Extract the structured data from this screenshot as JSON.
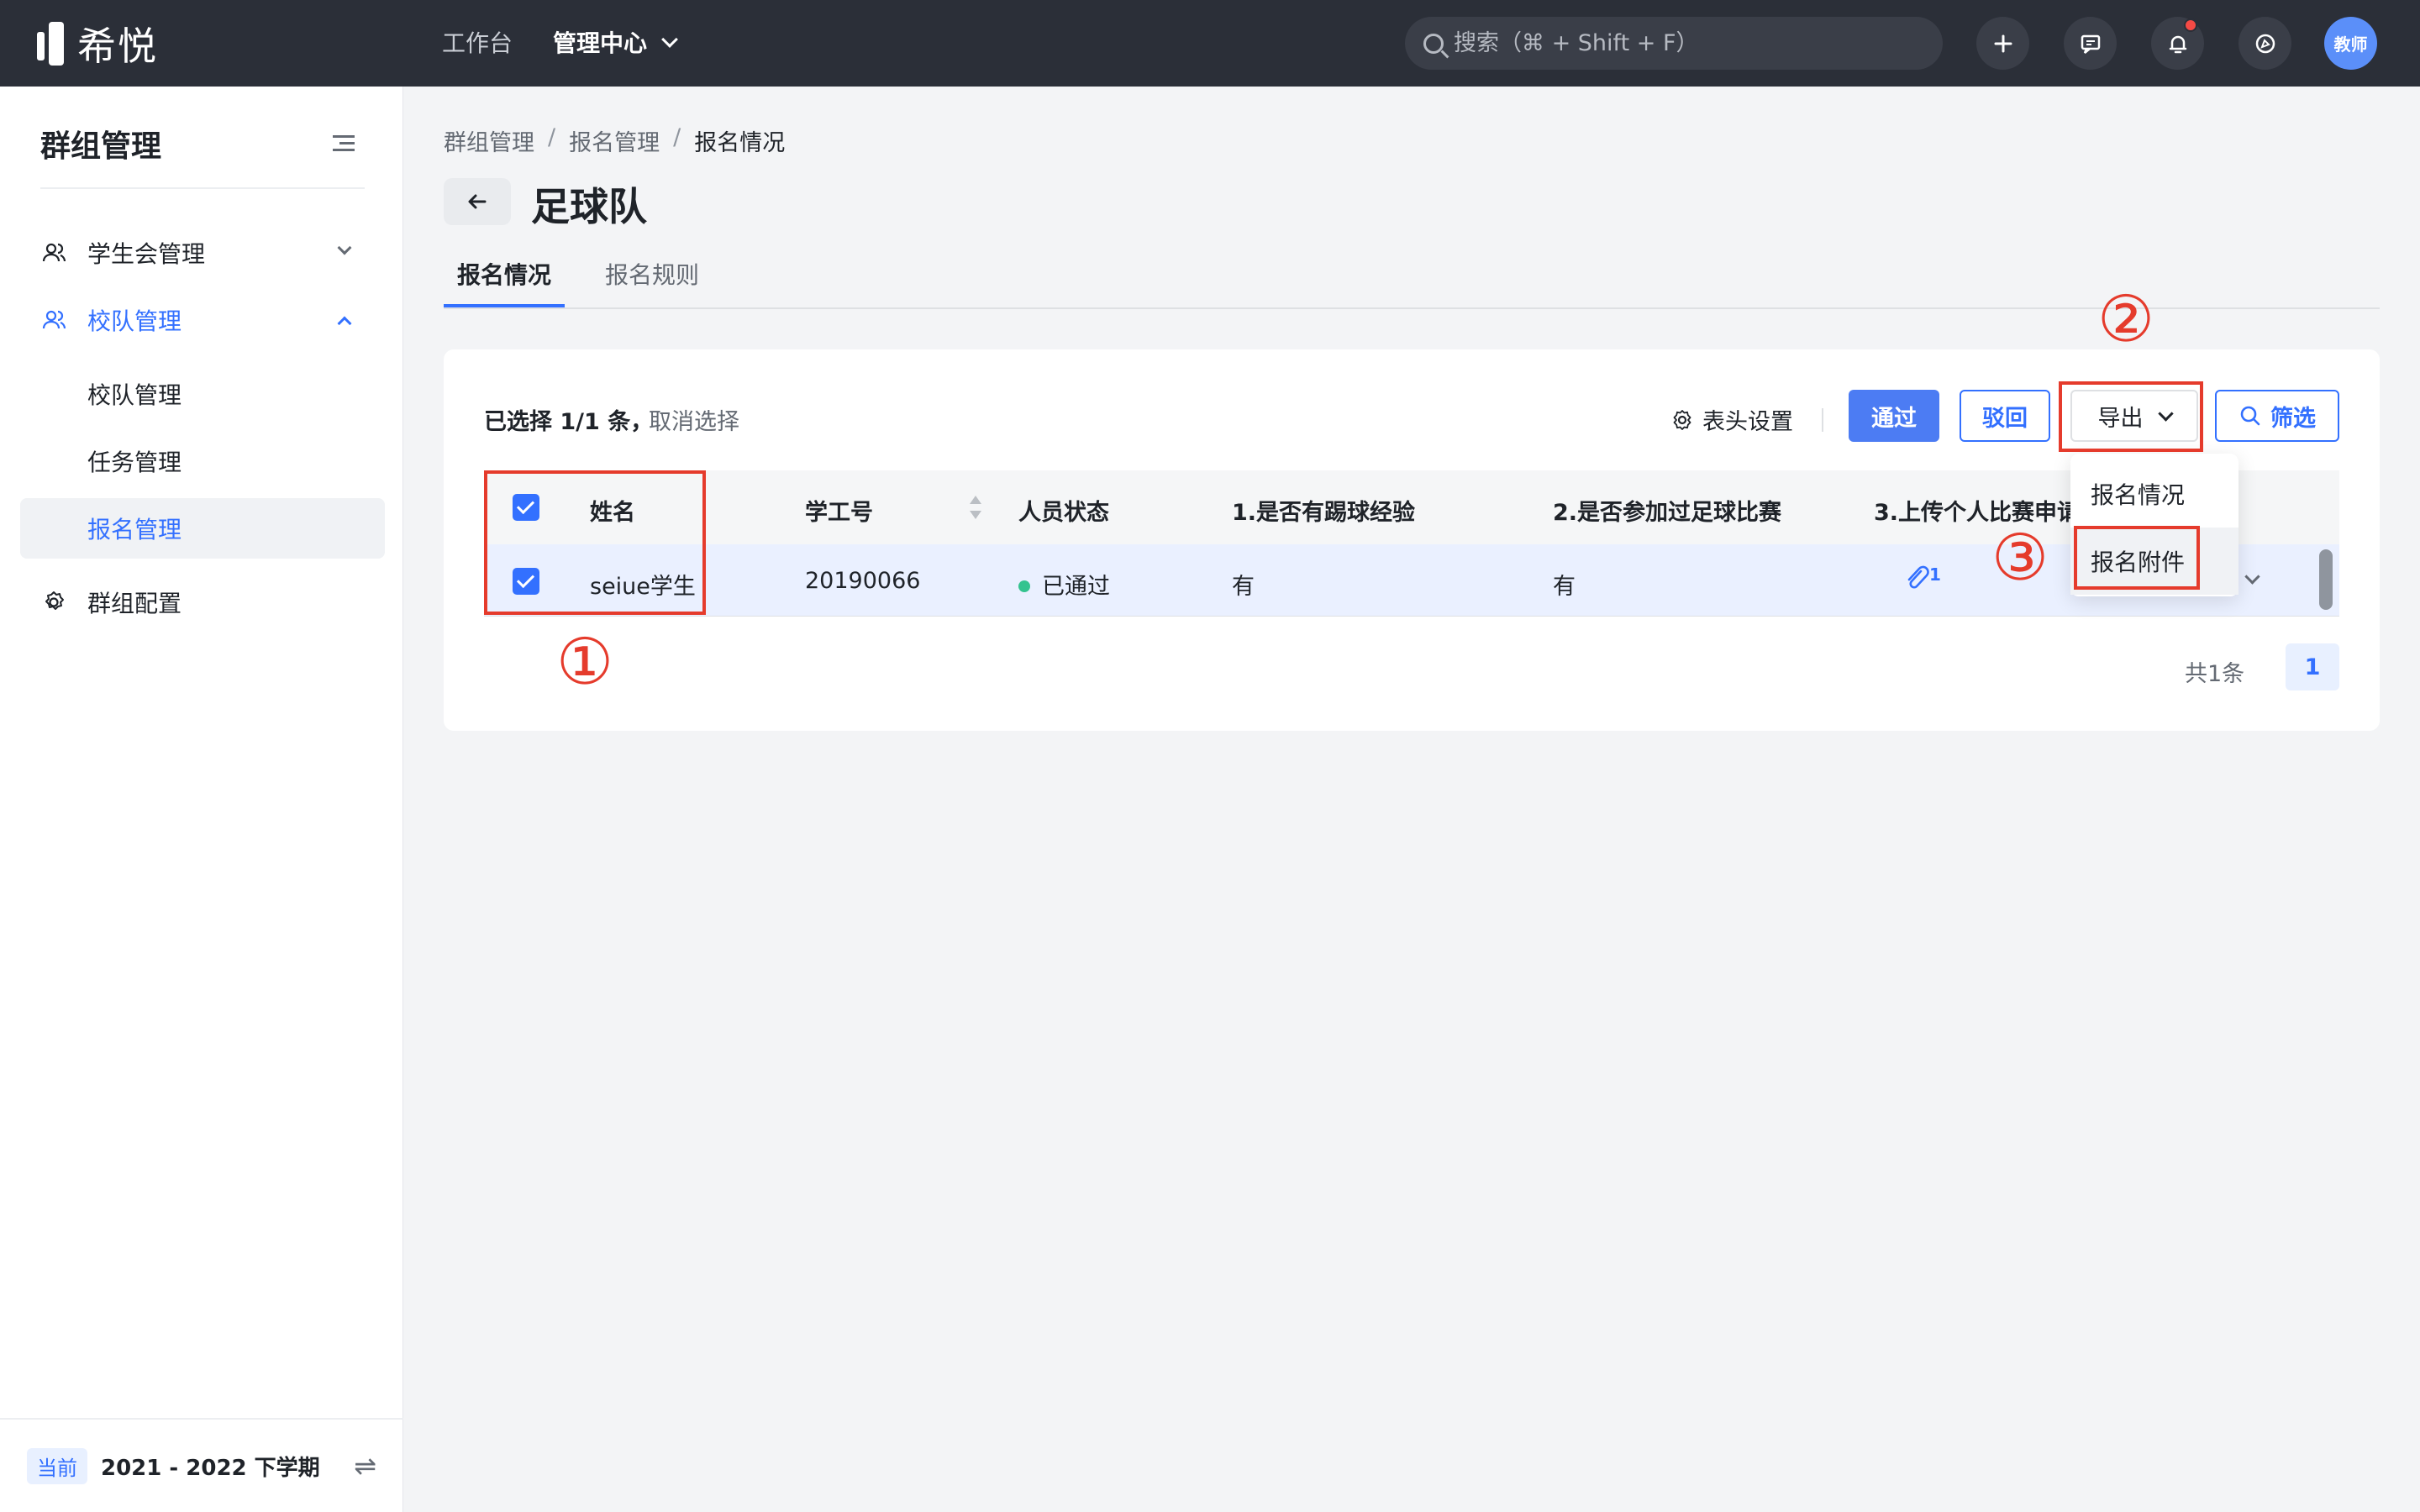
{
  "topbar": {
    "logo_text": "希悦",
    "nav": [
      {
        "label": "工作台"
      },
      {
        "label": "管理中心"
      }
    ],
    "search_placeholder": "搜索（⌘ + Shift + F）",
    "avatar_text": "教师"
  },
  "sidebar": {
    "title": "群组管理",
    "items": [
      {
        "label": "学生会管理"
      },
      {
        "label": "校队管理"
      },
      {
        "label": "群组配置"
      }
    ],
    "sub_items": [
      {
        "label": "校队管理"
      },
      {
        "label": "任务管理"
      },
      {
        "label": "报名管理"
      }
    ],
    "term_badge": "当前",
    "term_label": "2021 - 2022 下学期",
    "swap_glyph": "⇌"
  },
  "main": {
    "breadcrumb": [
      "群组管理",
      "报名管理",
      "报名情况"
    ],
    "breadcrumb_sep": "/",
    "title": "足球队",
    "tabs": [
      {
        "label": "报名情况"
      },
      {
        "label": "报名规则"
      }
    ],
    "toolbar": {
      "selected_text": "已选择 1/1 条，",
      "cancel_select": "取消选择",
      "column_settings": "表头设置",
      "approve": "通过",
      "reject": "驳回",
      "export": "导出",
      "filter": "筛选"
    },
    "table": {
      "headers": [
        "姓名",
        "学工号",
        "人员状态",
        "1.是否有踢球经验",
        "2.是否参加过足球比赛",
        "3.上传个人比赛申请"
      ],
      "row": {
        "name": "seiue学生",
        "id": "20190066",
        "status": "已通过",
        "q1": "有",
        "q2": "有",
        "attachments": "1"
      }
    },
    "pagination": {
      "total": "共1条",
      "page": "1"
    },
    "export_menu": [
      {
        "label": "报名情况"
      },
      {
        "label": "报名附件"
      }
    ]
  },
  "annotations": [
    "①",
    "②",
    "③"
  ],
  "colors": {
    "primary": "#3370ff",
    "topbar": "#2b2f38",
    "annotation": "#e53b2c",
    "status_ok": "#34c38f"
  }
}
